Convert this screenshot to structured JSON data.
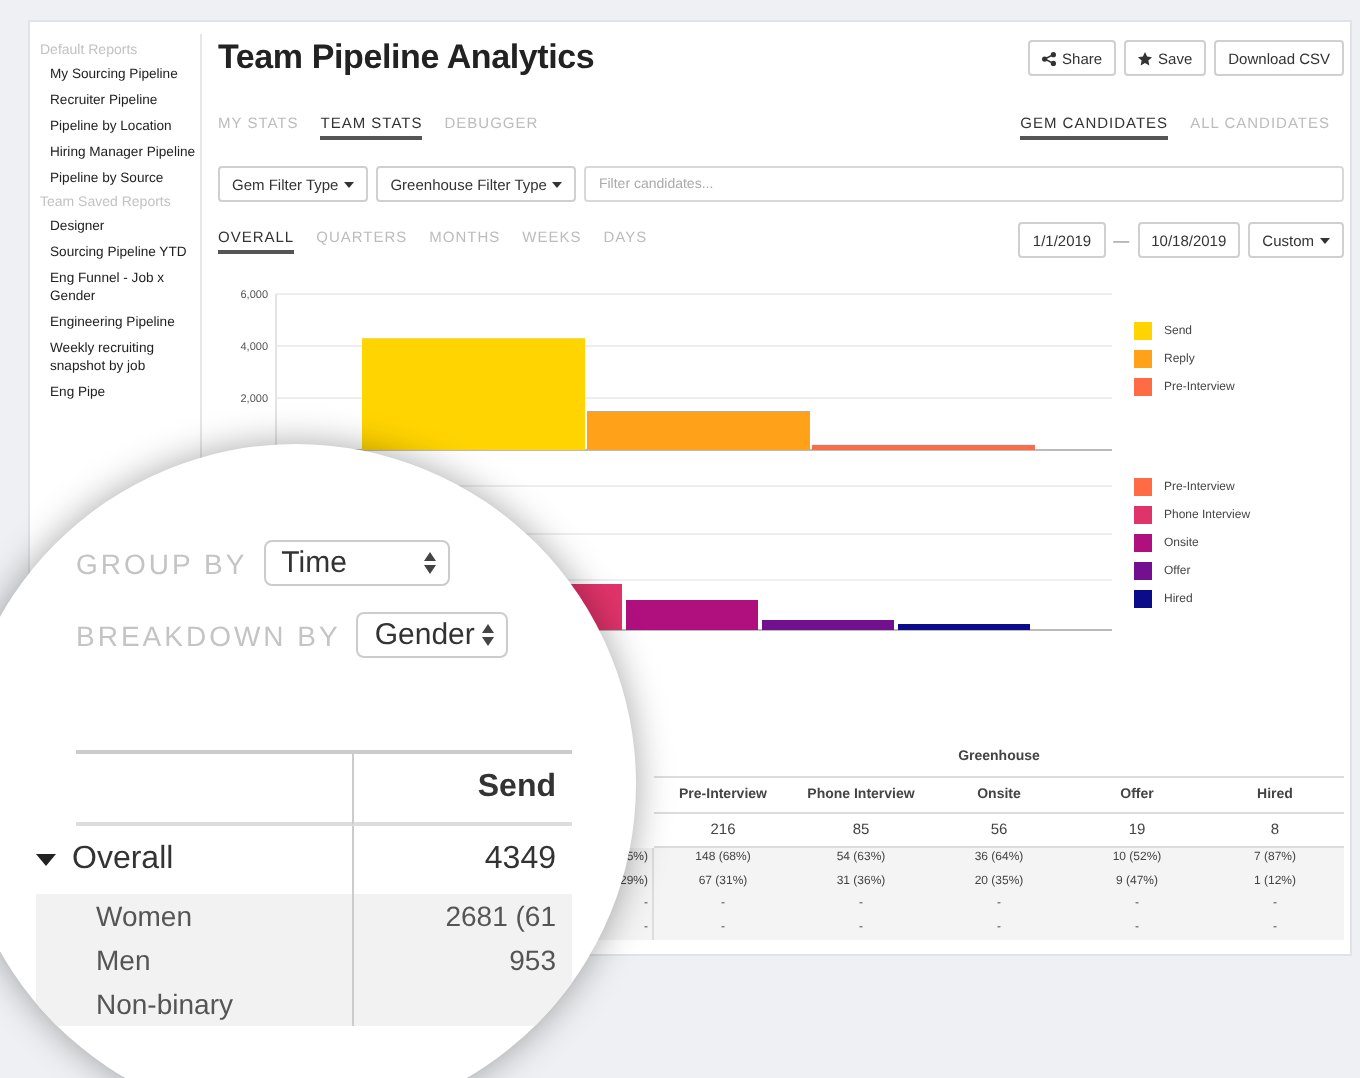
{
  "sidebar": {
    "sections": [
      {
        "heading": "Default Reports",
        "items": [
          "My Sourcing Pipeline",
          "Recruiter Pipeline",
          "Pipeline by Location",
          "Hiring Manager Pipeline",
          "Pipeline by Source"
        ]
      },
      {
        "heading": "Team Saved Reports",
        "items": [
          "Designer",
          "Sourcing Pipeline YTD",
          "Eng Funnel - Job x Gender",
          "Engineering Pipeline",
          "Weekly recruiting snapshot by job",
          "Eng Pipe"
        ]
      }
    ]
  },
  "title": "Team Pipeline Analytics",
  "actions": [
    {
      "kind": "share",
      "label": "Share"
    },
    {
      "kind": "save",
      "label": "Save"
    },
    {
      "kind": "plain",
      "label": "Download CSV"
    }
  ],
  "stat_tabs": [
    {
      "label": "MY STATS",
      "selected": false
    },
    {
      "label": "TEAM STATS",
      "selected": true
    },
    {
      "label": "DEBUGGER",
      "selected": false
    }
  ],
  "candidate_tabs": [
    {
      "label": "GEM CANDIDATES",
      "selected": true
    },
    {
      "label": "ALL CANDIDATES",
      "selected": false
    }
  ],
  "filters": [
    "Gem Filter Type",
    "Greenhouse Filter Type"
  ],
  "search": {
    "placeholder": "Filter candidates..."
  },
  "period_tabs": [
    {
      "label": "OVERALL",
      "selected": true
    },
    {
      "label": "QUARTERS",
      "selected": false
    },
    {
      "label": "MONTHS",
      "selected": false
    },
    {
      "label": "WEEKS",
      "selected": false
    },
    {
      "label": "DAYS",
      "selected": false
    }
  ],
  "date_range": {
    "start": "1/1/2019",
    "separator": "—",
    "end": "10/18/2019",
    "preset": "Custom"
  },
  "funnel_chart": {
    "chart_data": {
      "type": "bar",
      "ylim": [
        0,
        6000
      ],
      "yticks": [
        {
          "value": 2000,
          "label": "2,000"
        },
        {
          "value": 4000,
          "label": "4,000"
        },
        {
          "value": 6000,
          "label": "6,000"
        }
      ],
      "series": [
        {
          "name": "Send",
          "color": "#ffd400",
          "values": [
            4300
          ]
        },
        {
          "name": "Reply",
          "color": "#ffa21a",
          "values": [
            1500
          ]
        },
        {
          "name": "Pre-Interview",
          "color": "#ff6b45",
          "values": [
            200
          ]
        }
      ]
    }
  },
  "greenhouse_chart": {
    "legend": [
      {
        "label": "Pre-Interview",
        "color": "#ff6b45"
      },
      {
        "label": "Phone Interview",
        "color": "#e0336a"
      },
      {
        "label": "Onsite",
        "color": "#b0107e"
      },
      {
        "label": "Offer",
        "color": "#73108f"
      },
      {
        "label": "Hired",
        "color": "#0c0c8a"
      }
    ]
  },
  "table": {
    "group_label": "Greenhouse",
    "partial_column": [
      "5%)",
      "29%)",
      "-",
      "-"
    ],
    "columns": [
      "Pre-Interview",
      "Phone Interview",
      "Onsite",
      "Offer",
      "Hired"
    ],
    "totals": [
      "216",
      "85",
      "56",
      "19",
      "8"
    ],
    "rows": [
      [
        "148 (68%)",
        "54 (63%)",
        "36 (64%)",
        "10 (52%)",
        "7 (87%)"
      ],
      [
        "67 (31%)",
        "31 (36%)",
        "20 (35%)",
        "9 (47%)",
        "1 (12%)"
      ],
      [
        "-",
        "-",
        "-",
        "-",
        "-"
      ],
      [
        "-",
        "-",
        "-",
        "-",
        "-"
      ]
    ]
  },
  "magnifier": {
    "group_by": {
      "label": "GROUP BY",
      "value": "Time"
    },
    "breakdown_by": {
      "label": "BREAKDOWN BY",
      "value": "Gender"
    },
    "column": "Send",
    "overall": {
      "label": "Overall",
      "value": "4349",
      "expanded": true
    },
    "rows": [
      {
        "label": "Women",
        "value": "2681 (61"
      },
      {
        "label": "Men",
        "value": "953"
      },
      {
        "label": "Non-binary",
        "value": ""
      }
    ]
  }
}
